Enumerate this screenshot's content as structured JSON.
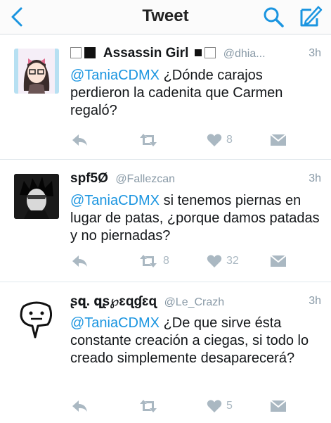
{
  "nav": {
    "title": "Tweet"
  },
  "tweets": [
    {
      "name": "Assassin Girl",
      "handle": "@dhia...",
      "time": "3h",
      "mention": "@TaniaCDMX",
      "text": " ¿Dónde carajos perdieron la cadenita que Carmen regaló?",
      "retweets": "",
      "likes": "8"
    },
    {
      "name": "spf5Ø",
      "handle": "@Fallezcan",
      "time": "3h",
      "mention": "@TaniaCDMX",
      "text": " si tenemos piernas en lugar de patas, ¿porque damos patadas y no piernadas?",
      "retweets": "8",
      "likes": "32"
    },
    {
      "name": "ʂզ. զʂ℘ɛɋɠɛɋ",
      "handle": "@Le_Crazh",
      "time": "3h",
      "mention": "@TaniaCDMX",
      "text": " ¿De que sirve ésta constante creación a ciegas, si todo lo creado simplemente desaparecerá?",
      "retweets": "",
      "likes": "5"
    }
  ],
  "colors": {
    "accent": "#1b95e0",
    "icon": "#aab8c2",
    "divider": "#e1e8ed"
  }
}
